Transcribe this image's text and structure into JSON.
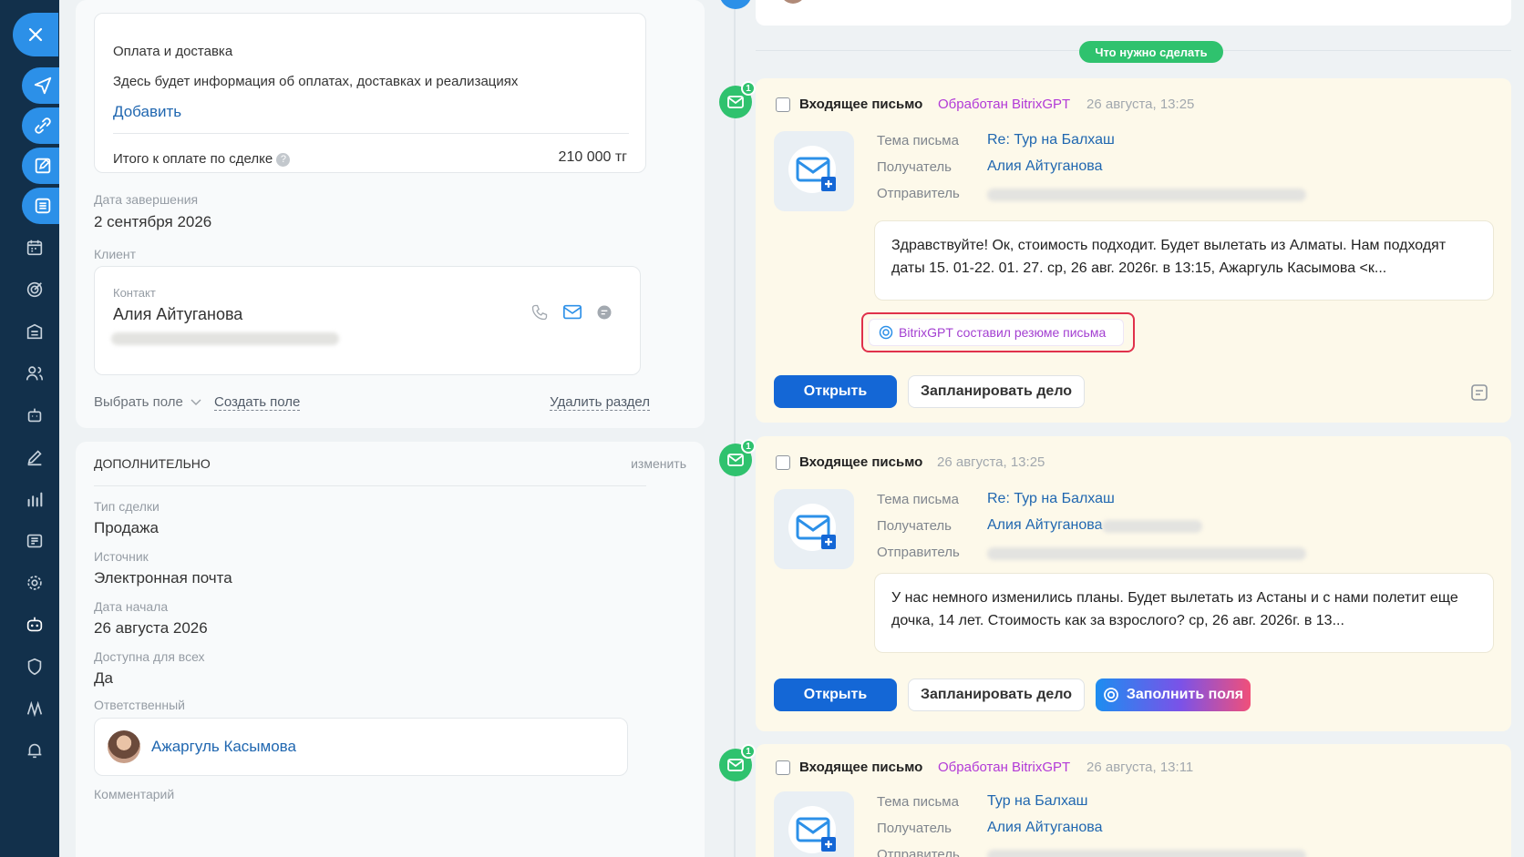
{
  "colors": {
    "sidebar": "#12304b",
    "accent": "#2c90e8",
    "primary_button": "#1467d6",
    "gpt_purple": "#b23ad7",
    "success": "#2fc26e",
    "highlight_red": "#e0314b"
  },
  "sidebar": {
    "close_icon": "close-icon",
    "items": [
      "send-icon",
      "link-icon",
      "edit-icon",
      "list-icon",
      "calendar-icon",
      "target-icon",
      "building-icon",
      "users-icon",
      "robot-icon",
      "pen-icon",
      "chart-icon",
      "news-icon",
      "settings-icon",
      "bot-icon",
      "shield-icon",
      "wave-icon",
      "bell-icon"
    ]
  },
  "payment": {
    "title": "Оплата и доставка",
    "description": "Здесь будет информация об оплатах, доставках и реализациях",
    "add_link": "Добавить",
    "total_label": "Итого к оплате по сделке",
    "total_value": "210 000 тг"
  },
  "deal": {
    "end_date_label": "Дата завершения",
    "end_date_value": "2 сентября 2026",
    "client_label": "Клиент",
    "contact_label": "Контакт",
    "contact_name": "Алия Айтуганова",
    "select_field": "Выбрать поле",
    "create_field": "Создать поле",
    "delete_section": "Удалить раздел"
  },
  "additional": {
    "title": "ДОПОЛНИТЕЛЬНО",
    "edit": "изменить",
    "fields": [
      {
        "label": "Тип сделки",
        "value": "Продажа"
      },
      {
        "label": "Источник",
        "value": "Электронная почта"
      },
      {
        "label": "Дата начала",
        "value": "26 августа 2026"
      },
      {
        "label": "Доступна для всех",
        "value": "Да"
      }
    ],
    "responsible_label": "Ответственный",
    "responsible_name": "Ажаргуль Касымова",
    "comment_label": "Комментарий"
  },
  "timeline": {
    "todo_pill": "Что нужно сделать",
    "badge": "1",
    "subject_label": "Тема письма",
    "recipient_label": "Получатель",
    "sender_label": "Отправитель",
    "open_button": "Открыть",
    "plan_button": "Запланировать дело",
    "fill_button": "Заполнить поля",
    "gpt_summary": "BitrixGPT составил резюме письма",
    "emails": [
      {
        "title": "Входящее письмо",
        "gpt": "Обработан BitrixGPT",
        "date": "26 августа, 13:25",
        "subject": "Re: Тур на Балхаш",
        "recipient": "Алия Айтуганова",
        "message": "Здравствуйте! Ок, стоимость подходит. Будет вылетать из Алматы. Нам подходят даты 15. 01-22. 01. 27. ср, 26 авг. 2026г. в 13:15, Ажаргуль Касымова <к..."
      },
      {
        "title": "Входящее письмо",
        "gpt": "",
        "date": "26 августа, 13:25",
        "subject": "Re: Тур на Балхаш",
        "recipient": "Алия Айтуганова",
        "message": "У нас немного изменились планы. Будет вылетать из Астаны и с нами полетит еще дочка, 14 лет. Стоимость как за взрослого? ср, 26 авг. 2026г. в 13..."
      },
      {
        "title": "Входящее письмо",
        "gpt": "Обработан BitrixGPT",
        "date": "26 августа, 13:11",
        "subject": "Тур на Балхаш",
        "recipient": "Алия Айтуганова",
        "message": ""
      }
    ]
  }
}
